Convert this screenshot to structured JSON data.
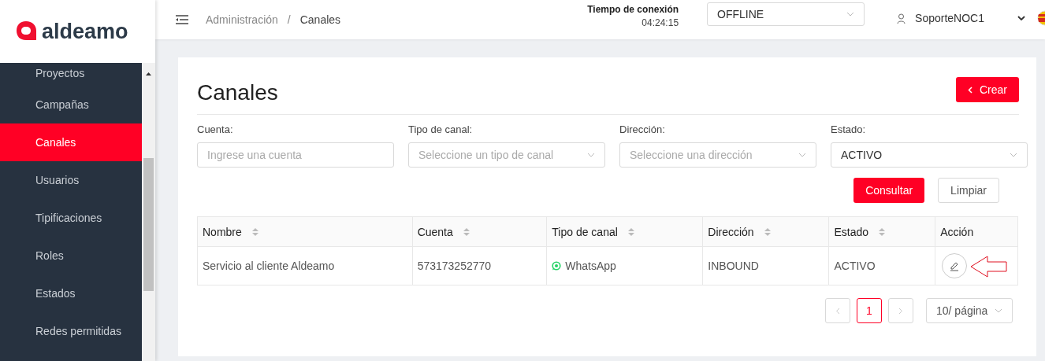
{
  "brand": {
    "name": "aldeamo"
  },
  "sidebar": {
    "items": [
      {
        "label": "Proyectos",
        "selected": false
      },
      {
        "label": "Campañas",
        "selected": false
      },
      {
        "label": "Canales",
        "selected": true
      },
      {
        "label": "Usuarios",
        "selected": false
      },
      {
        "label": "Tipificaciones",
        "selected": false
      },
      {
        "label": "Roles",
        "selected": false
      },
      {
        "label": "Estados",
        "selected": false
      },
      {
        "label": "Redes permitidas",
        "selected": false
      }
    ]
  },
  "header": {
    "breadcrumb": [
      "Administración",
      "Canales"
    ],
    "breadcrumb_separator": "/",
    "connection_label": "Tiempo de conexión",
    "connection_time": "04:24:15",
    "status_select": "OFFLINE",
    "user": "SoporteNOC1"
  },
  "page": {
    "title": "Canales",
    "create_button": "Crear",
    "filters": [
      {
        "label": "Cuenta:",
        "kind": "input",
        "placeholder": "Ingrese una cuenta"
      },
      {
        "label": "Tipo de canal:",
        "kind": "select",
        "placeholder": "Seleccione un tipo de canal"
      },
      {
        "label": "Dirección:",
        "kind": "select",
        "placeholder": "Seleccione una dirección"
      },
      {
        "label": "Estado:",
        "kind": "select",
        "value": "ACTIVO"
      }
    ],
    "search_button": "Consultar",
    "clear_button": "Limpiar",
    "table": {
      "columns": [
        {
          "label": "Nombre",
          "sortable": true,
          "kind": "text"
        },
        {
          "label": "Cuenta",
          "sortable": true,
          "kind": "text"
        },
        {
          "label": "Tipo de canal",
          "sortable": true,
          "kind": "channel"
        },
        {
          "label": "Dirección",
          "sortable": true,
          "kind": "text"
        },
        {
          "label": "Estado",
          "sortable": true,
          "kind": "text"
        },
        {
          "label": "Acción",
          "sortable": false,
          "kind": "action"
        }
      ],
      "rows": [
        {
          "cells": [
            "Servicio al cliente Aldeamo",
            "573173252770",
            "WhatsApp",
            "INBOUND",
            "ACTIVO"
          ]
        }
      ]
    },
    "pagination": {
      "pages": [
        {
          "label": "1",
          "selected": true
        }
      ],
      "page_size": "10/ página"
    }
  }
}
